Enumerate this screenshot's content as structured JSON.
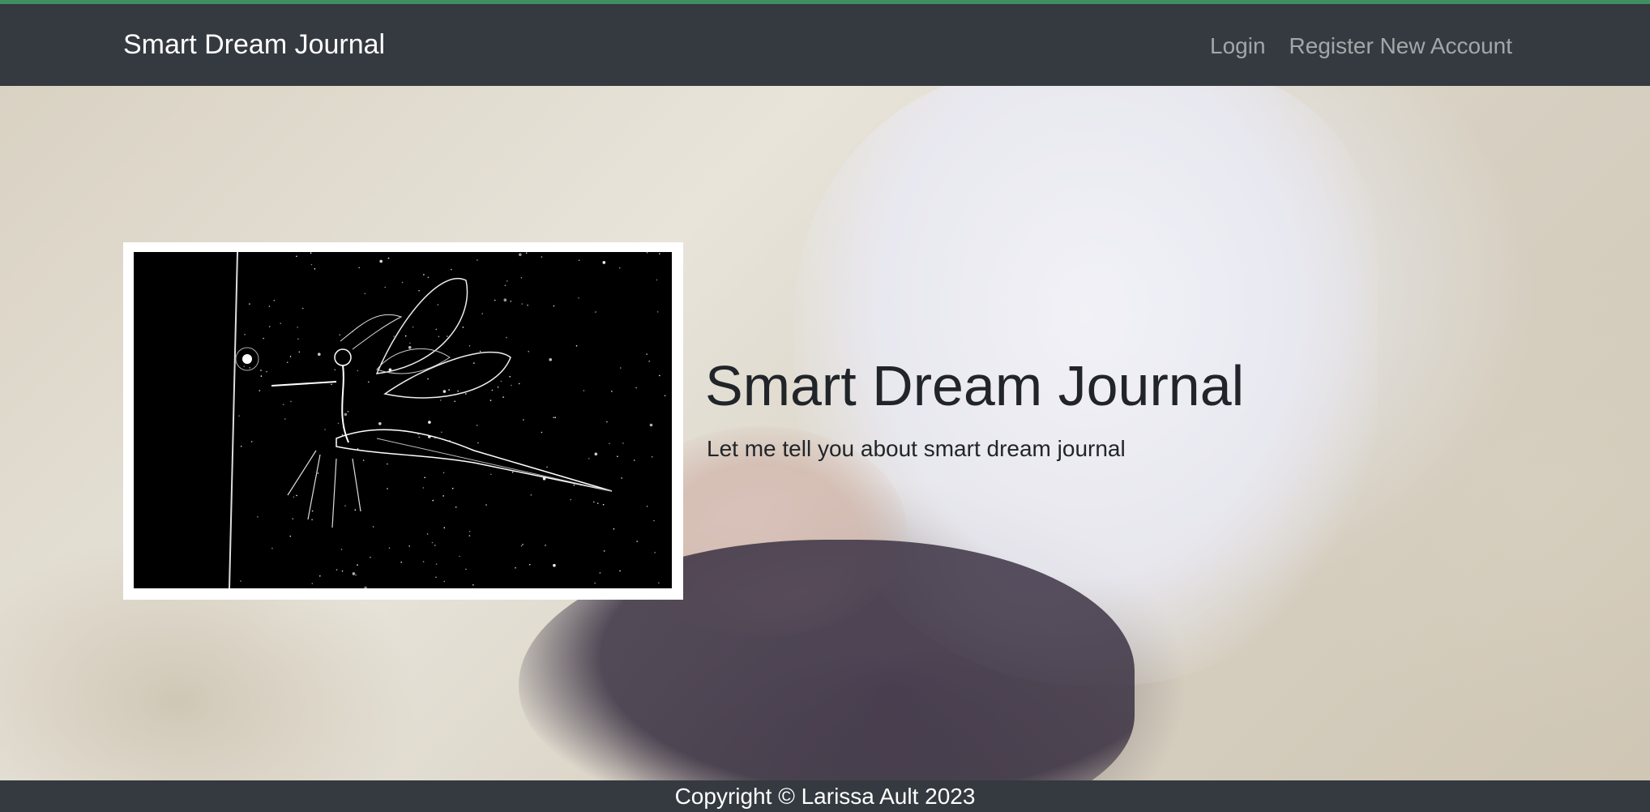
{
  "navbar": {
    "brand": "Smart Dream Journal",
    "links": [
      "Login",
      "Register New Account"
    ]
  },
  "hero": {
    "title": "Smart Dream Journal",
    "subtitle": "Let me tell you about smart dream journal",
    "illustration": "fairy riding a dragonfly in a starry night sky"
  },
  "footer": {
    "copyright": "Copyright © Larissa Ault 2023"
  },
  "colors": {
    "accent_line": "#3f8f63",
    "navbar_bg": "#343a40",
    "nav_link": "rgba(255,255,255,0.55)",
    "text_dark": "#212529"
  }
}
